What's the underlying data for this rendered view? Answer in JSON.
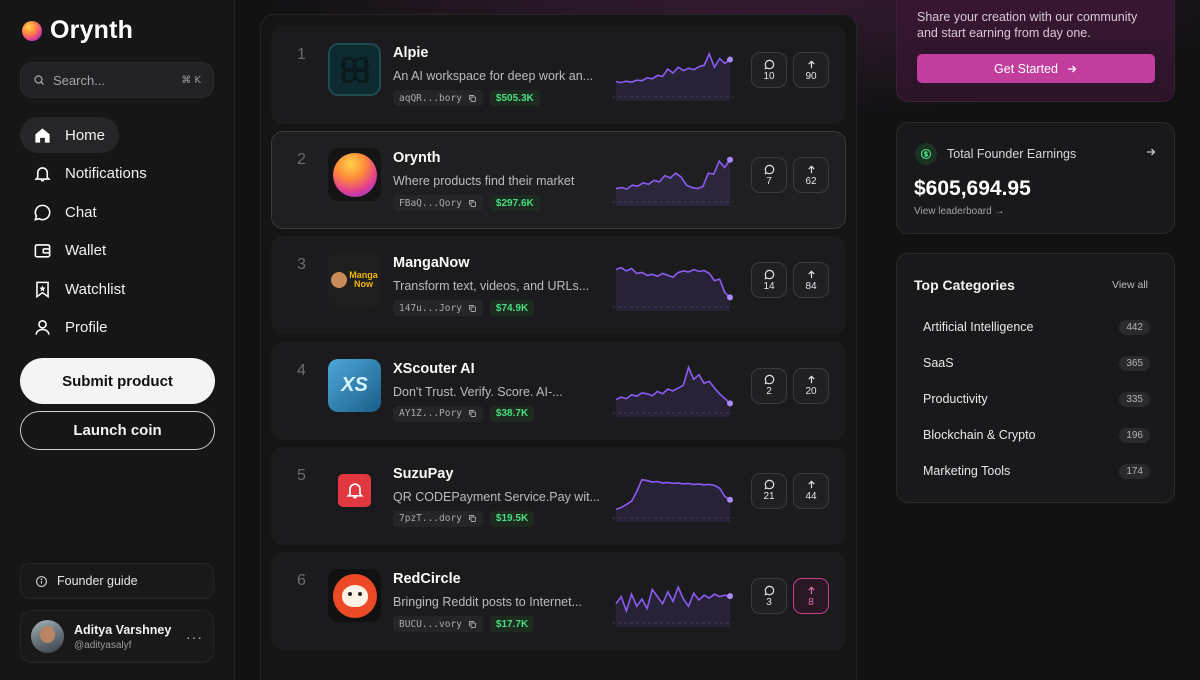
{
  "brand": {
    "name": "Orynth"
  },
  "search": {
    "placeholder": "Search...",
    "shortcut": "⌘ K"
  },
  "nav": [
    {
      "label": "Home",
      "icon": "home-icon",
      "active": true
    },
    {
      "label": "Notifications",
      "icon": "bell-icon"
    },
    {
      "label": "Chat",
      "icon": "chat-icon"
    },
    {
      "label": "Wallet",
      "icon": "wallet-icon"
    },
    {
      "label": "Watchlist",
      "icon": "bookmark-icon"
    },
    {
      "label": "Profile",
      "icon": "user-icon"
    }
  ],
  "actions": {
    "submit": "Submit product",
    "launch": "Launch coin"
  },
  "guide": {
    "label": "Founder guide"
  },
  "user": {
    "name": "Aditya Varshney",
    "handle": "@adityasalyf"
  },
  "products": [
    {
      "rank": "1",
      "name": "Alpie",
      "desc": "An AI workspace for deep work an...",
      "address": "aqQR...bory",
      "mcap": "$505.3K",
      "comments": "10",
      "upvotes": "90",
      "upvoted": false,
      "highlight": false,
      "thumb": "alpie-logo",
      "trend": [
        0.32,
        0.3,
        0.33,
        0.31,
        0.35,
        0.34,
        0.4,
        0.38,
        0.45,
        0.43,
        0.58,
        0.5,
        0.62,
        0.55,
        0.6,
        0.57,
        0.63,
        0.66,
        0.9,
        0.62,
        0.8,
        0.7,
        0.78
      ]
    },
    {
      "rank": "2",
      "name": "Orynth",
      "desc": "Where products find their market",
      "address": "FBaQ...Qory",
      "mcap": "$297.6K",
      "comments": "7",
      "upvotes": "62",
      "upvoted": false,
      "highlight": true,
      "thumb": "orynth-logo",
      "trend": [
        0.28,
        0.3,
        0.27,
        0.35,
        0.33,
        0.4,
        0.37,
        0.45,
        0.42,
        0.55,
        0.5,
        0.6,
        0.52,
        0.35,
        0.3,
        0.28,
        0.32,
        0.6,
        0.58,
        0.85,
        0.72,
        0.88
      ]
    },
    {
      "rank": "3",
      "name": "MangaNow",
      "desc": "Transform text, videos, and URLs...",
      "address": "147u...Jory",
      "mcap": "$74.9K",
      "comments": "14",
      "upvotes": "84",
      "upvoted": false,
      "highlight": false,
      "thumb": "manganow-logo",
      "trend": [
        0.78,
        0.82,
        0.75,
        0.8,
        0.7,
        0.72,
        0.66,
        0.68,
        0.64,
        0.7,
        0.66,
        0.62,
        0.72,
        0.75,
        0.73,
        0.78,
        0.74,
        0.76,
        0.7,
        0.55,
        0.58,
        0.3,
        0.2
      ]
    },
    {
      "rank": "4",
      "name": "XScouter AI",
      "desc": "Don't Trust. Verify. Score. AI-...",
      "address": "AY1Z...Pory",
      "mcap": "$38.7K",
      "comments": "2",
      "upvotes": "20",
      "upvoted": false,
      "highlight": false,
      "thumb": "xscouter-logo",
      "trend": [
        0.28,
        0.33,
        0.3,
        0.38,
        0.35,
        0.42,
        0.4,
        0.36,
        0.45,
        0.4,
        0.5,
        0.46,
        0.52,
        0.58,
        0.95,
        0.7,
        0.8,
        0.62,
        0.66,
        0.52,
        0.4,
        0.3,
        0.2
      ]
    },
    {
      "rank": "5",
      "name": "SuzuPay",
      "desc": "QR CODEPayment Service.Pay wit...",
      "address": "7pzT...dory",
      "mcap": "$19.5K",
      "comments": "21",
      "upvotes": "44",
      "upvoted": false,
      "highlight": false,
      "thumb": "suzupay-logo",
      "trend": [
        0.18,
        0.22,
        0.28,
        0.35,
        0.55,
        0.8,
        0.78,
        0.75,
        0.76,
        0.73,
        0.74,
        0.72,
        0.73,
        0.71,
        0.72,
        0.7,
        0.71,
        0.69,
        0.7,
        0.68,
        0.62,
        0.45,
        0.38
      ]
    },
    {
      "rank": "6",
      "name": "RedCircle",
      "desc": "Bringing Reddit posts to Internet...",
      "address": "BUCU...vory",
      "mcap": "$17.7K",
      "comments": "3",
      "upvotes": "8",
      "upvoted": true,
      "highlight": false,
      "thumb": "redcircle-logo",
      "trend": [
        0.4,
        0.55,
        0.25,
        0.6,
        0.35,
        0.5,
        0.3,
        0.7,
        0.55,
        0.4,
        0.65,
        0.45,
        0.75,
        0.5,
        0.35,
        0.62,
        0.48,
        0.58,
        0.52,
        0.6,
        0.55,
        0.58,
        0.56
      ]
    }
  ],
  "promo": {
    "text": "Share your creation with our community and start earning from day one.",
    "cta": "Get Started"
  },
  "earnings": {
    "title": "Total Founder Earnings",
    "value": "$605,694.95",
    "link": "View leaderboard →"
  },
  "categories": {
    "title": "Top Categories",
    "view_all": "View all",
    "items": [
      {
        "name": "Artificial Intelligence",
        "count": "442"
      },
      {
        "name": "SaaS",
        "count": "365"
      },
      {
        "name": "Productivity",
        "count": "335"
      },
      {
        "name": "Blockchain & Crypto",
        "count": "196"
      },
      {
        "name": "Marketing Tools",
        "count": "174"
      }
    ]
  },
  "colors": {
    "accent": "#c13e9d",
    "line": "#8b5cf6",
    "money": "#4ade80"
  }
}
